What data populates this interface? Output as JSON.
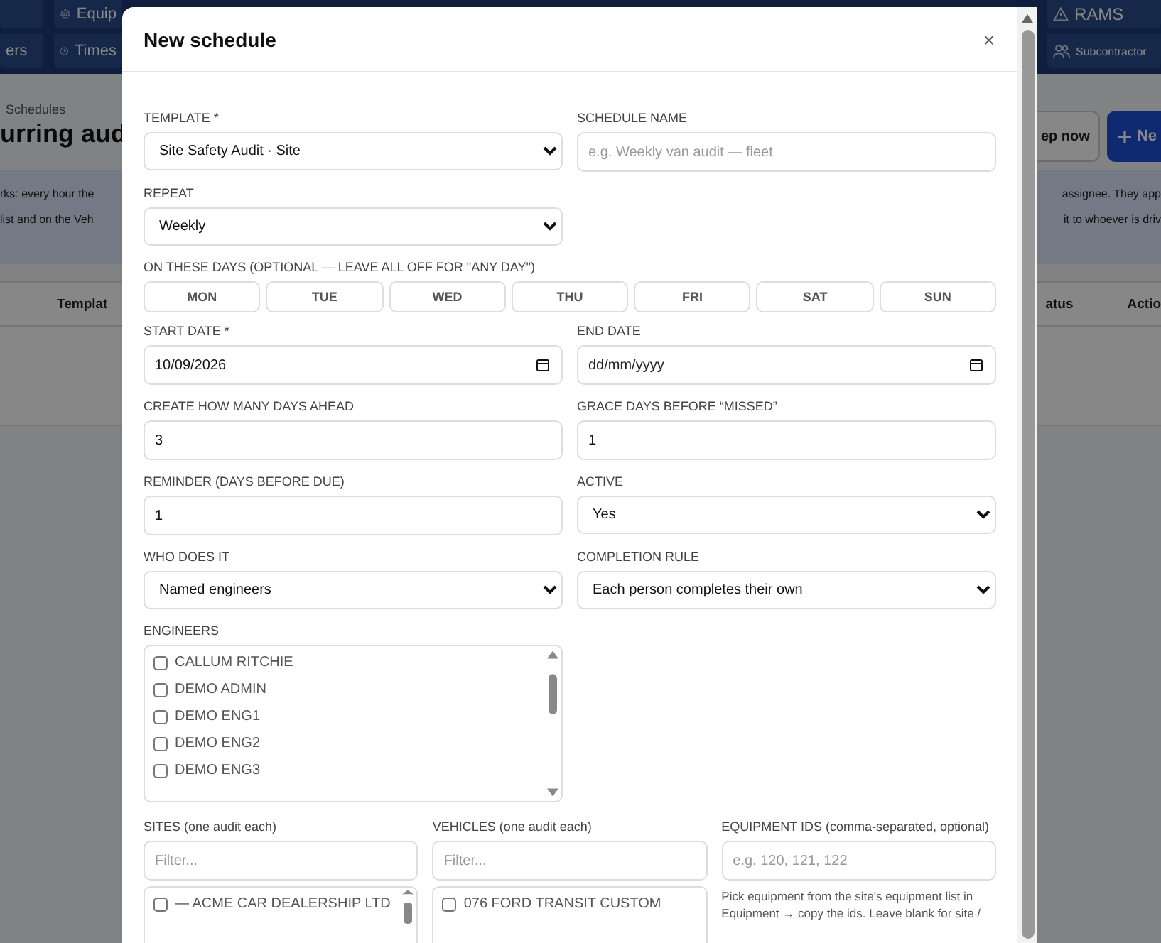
{
  "background": {
    "nav_left": [
      {
        "label": "Equip"
      },
      {
        "label": "ers"
      },
      {
        "label": "Times"
      }
    ],
    "nav_right": [
      {
        "label": "RAMS"
      },
      {
        "label": "Subcontractor"
      }
    ],
    "breadcrumb": "Schedules",
    "title": "urring aud",
    "buttons": [
      {
        "label": "ep now",
        "kind": "outline"
      },
      {
        "label": "Ne",
        "kind": "primary"
      }
    ],
    "info_left": [
      "rks: every hour the",
      "list and on the Veh"
    ],
    "info_right": [
      "assignee. They app",
      "it to whoever is driv"
    ],
    "columns_left": [
      "Templat"
    ],
    "columns_right": [
      "atus",
      "Actio"
    ]
  },
  "modal": {
    "title": "New schedule",
    "close": "×",
    "template": {
      "label": "TEMPLATE *",
      "value": "Site Safety Audit · Site"
    },
    "schedule_name": {
      "label": "SCHEDULE NAME",
      "placeholder": "e.g. Weekly van audit — fleet"
    },
    "repeat": {
      "label": "REPEAT",
      "value": "Weekly"
    },
    "days_label": "ON THESE DAYS (OPTIONAL — LEAVE ALL OFF FOR \"ANY DAY\")",
    "days": [
      {
        "label": "MON",
        "selected": false
      },
      {
        "label": "TUE",
        "selected": false
      },
      {
        "label": "WED",
        "selected": false
      },
      {
        "label": "THU",
        "selected": false
      },
      {
        "label": "FRI",
        "selected": false
      },
      {
        "label": "SAT",
        "selected": false
      },
      {
        "label": "SUN",
        "selected": false
      }
    ],
    "start_date": {
      "label": "START DATE *",
      "value": "10/09/2026"
    },
    "end_date": {
      "label": "END DATE",
      "placeholder": "dd/mm/yyyy"
    },
    "days_ahead": {
      "label": "CREATE HOW MANY DAYS AHEAD",
      "value": "3"
    },
    "grace_days": {
      "label": "GRACE DAYS BEFORE “MISSED”",
      "value": "1"
    },
    "reminder": {
      "label": "REMINDER (DAYS BEFORE DUE)",
      "value": "1"
    },
    "active": {
      "label": "ACTIVE",
      "value": "Yes"
    },
    "who": {
      "label": "WHO DOES IT",
      "value": "Named engineers"
    },
    "completion": {
      "label": "COMPLETION RULE",
      "value": "Each person completes their own"
    },
    "engineers": {
      "label": "ENGINEERS",
      "items": [
        {
          "name": "CALLUM RITCHIE",
          "checked": false
        },
        {
          "name": "DEMO ADMIN",
          "checked": false
        },
        {
          "name": "DEMO ENG1",
          "checked": false
        },
        {
          "name": "DEMO ENG2",
          "checked": false
        },
        {
          "name": "DEMO ENG3",
          "checked": false
        }
      ]
    },
    "sites": {
      "label": "SITES (one audit each)",
      "placeholder": "Filter...",
      "items": [
        {
          "name": "— ACME CAR DEALERSHIP LTD",
          "checked": false
        }
      ]
    },
    "vehicles": {
      "label": "VEHICLES (one audit each)",
      "placeholder": "Filter...",
      "items": [
        {
          "name": "076 FORD TRANSIT CUSTOM",
          "checked": false
        }
      ]
    },
    "equipment": {
      "label": "EQUIPMENT IDS (comma-separated, optional)",
      "placeholder": "e.g. 120, 121, 122",
      "hint": "Pick equipment from the site's equipment list in Equipment → copy the ids. Leave blank for site /"
    }
  }
}
